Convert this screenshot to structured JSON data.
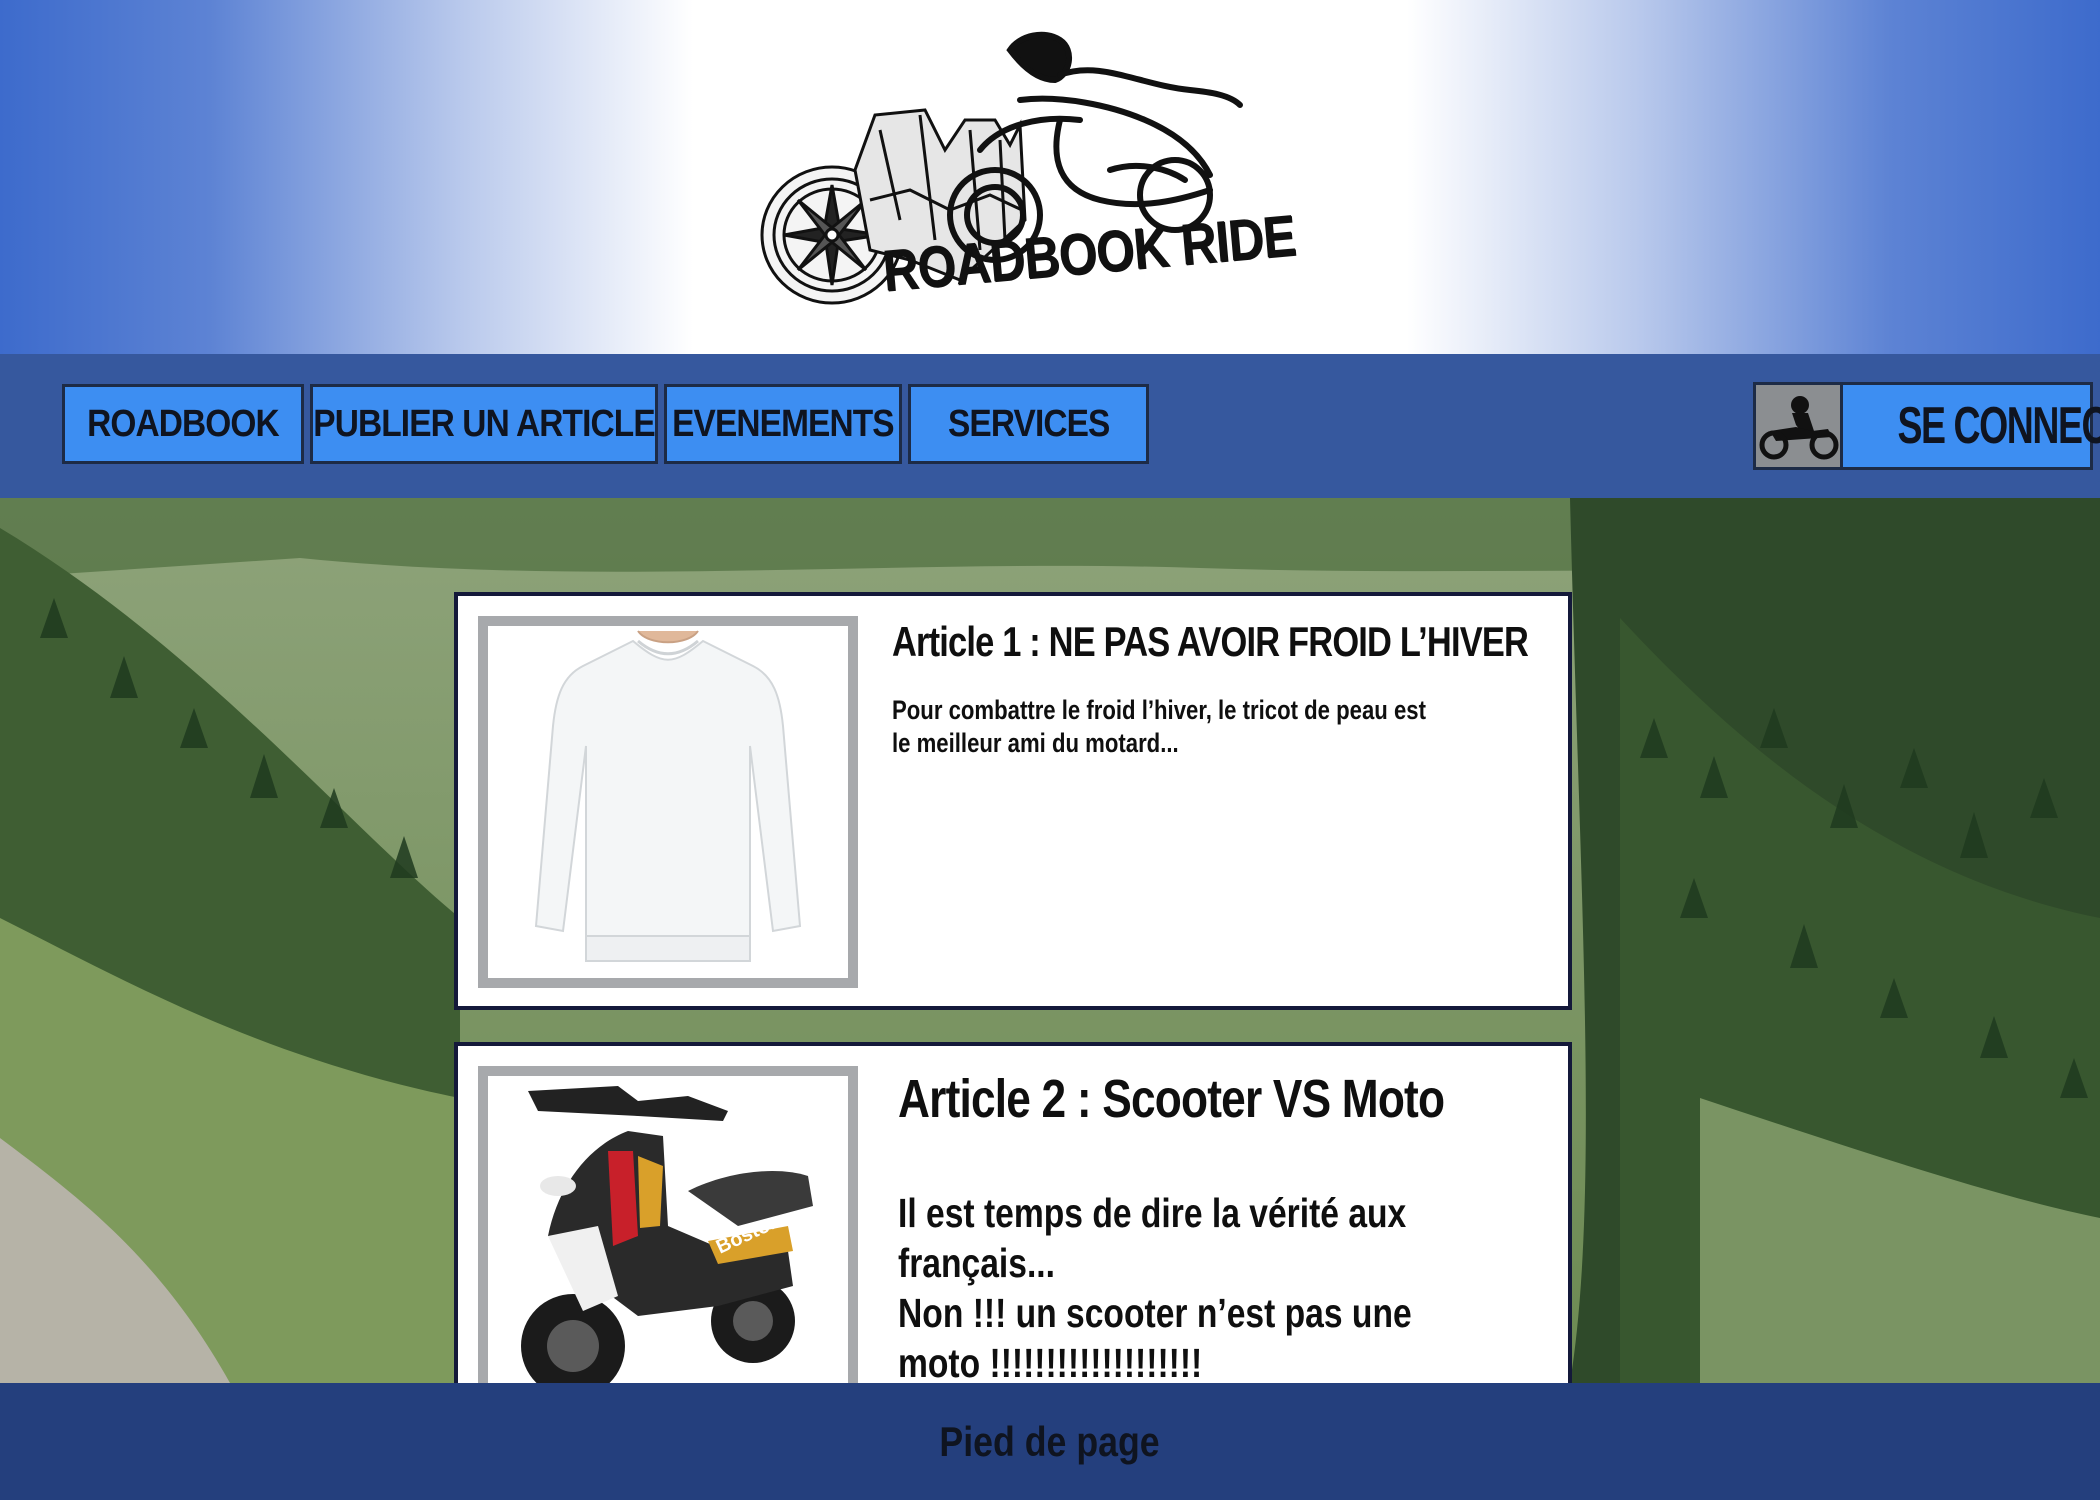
{
  "header": {
    "logo_text": "ROADBOOK RIDE"
  },
  "nav": {
    "items": [
      {
        "label": "ROADBOOK"
      },
      {
        "label": "PUBLIER UN ARTICLE"
      },
      {
        "label": "EVENEMENTS"
      },
      {
        "label": "SERVICES"
      }
    ],
    "login_label": "SE CONNECTER",
    "login_icon": "motorcycle-icon"
  },
  "articles": [
    {
      "title": "Article 1 :  NE PAS AVOIR FROID L’HIVER",
      "body": "Pour combattre le froid l’hiver, le tricot de peau est le meilleur ami du motard...",
      "image": "white-long-sleeve-shirt"
    },
    {
      "title": "Article 2 : Scooter VS Moto",
      "body_line1": "Il est temps de dire la vérité aux français...",
      "body_line2": "Non !!! un scooter n’est pas une moto !!!!!!!!!!!!!!!!!!!",
      "image": "scooter",
      "image_brand": "Boston"
    }
  ],
  "footer": {
    "label": "Pied de page"
  },
  "colors": {
    "nav_bg": "#36589e",
    "button_bg": "#3d8ef2",
    "footer_bg": "#243f7d",
    "header_edge": "#3d6bcc"
  }
}
